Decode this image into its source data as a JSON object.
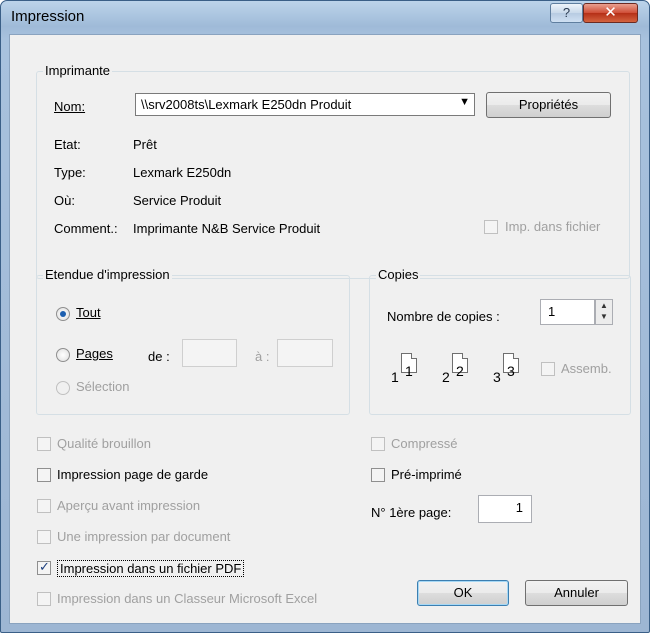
{
  "window": {
    "title": "Impression",
    "help_glyph": "?",
    "close_glyph": "✕"
  },
  "printer": {
    "group_label": "Imprimante",
    "name_label": "Nom:",
    "name_value": "\\\\srv2008ts\\Lexmark E250dn Produit",
    "properties_button": "Propriétés",
    "state_label": "Etat:",
    "state_value": "Prêt",
    "type_label": "Type:",
    "type_value": "Lexmark E250dn",
    "where_label": "Où:",
    "where_value": "Service Produit",
    "comment_label": "Comment.:",
    "comment_value": "Imprimante N&B Service Produit",
    "print_to_file": {
      "label": "Imp. dans fichier",
      "checked": false,
      "enabled": false
    }
  },
  "range": {
    "group_label": "Etendue d'impression",
    "all_label": "Tout",
    "pages_label": "Pages",
    "from_label": "de :",
    "from_value": "",
    "to_label": "à :",
    "to_value": "",
    "selection_label": "Sélection",
    "selected": "all"
  },
  "copies": {
    "group_label": "Copies",
    "count_label": "Nombre de copies :",
    "count_value": "1",
    "collate_label": "Assemb.",
    "collate_checked": false,
    "icon_numbers": [
      "1",
      "1",
      "2",
      "2",
      "3",
      "3"
    ]
  },
  "options": {
    "draft": {
      "label": "Qualité brouillon",
      "checked": false,
      "enabled": false
    },
    "cover_page": {
      "label": "Impression page de garde",
      "checked": false,
      "enabled": true
    },
    "preview": {
      "label": "Aperçu avant impression",
      "checked": false,
      "enabled": false
    },
    "one_per_doc": {
      "label": "Une impression par document",
      "checked": false,
      "enabled": false
    },
    "pdf": {
      "label": "Impression dans un fichier PDF",
      "checked": true,
      "enabled": true
    },
    "excel": {
      "label": "Impression dans un Classeur Microsoft Excel",
      "checked": false,
      "enabled": false
    },
    "compressed": {
      "label": "Compressé",
      "checked": false,
      "enabled": false
    },
    "preprinted": {
      "label": "Pré-imprimé",
      "checked": false,
      "enabled": true
    },
    "first_page_label": "N° 1ère page:",
    "first_page_value": "1"
  },
  "buttons": {
    "ok": "OK",
    "cancel": "Annuler"
  },
  "check_glyph": "✓",
  "colors": {
    "title_bar": "#a8c2de",
    "close_button": "#c8472f",
    "dialog_bg": "#f0f0f0",
    "radio_dot": "#1c5fb0"
  }
}
